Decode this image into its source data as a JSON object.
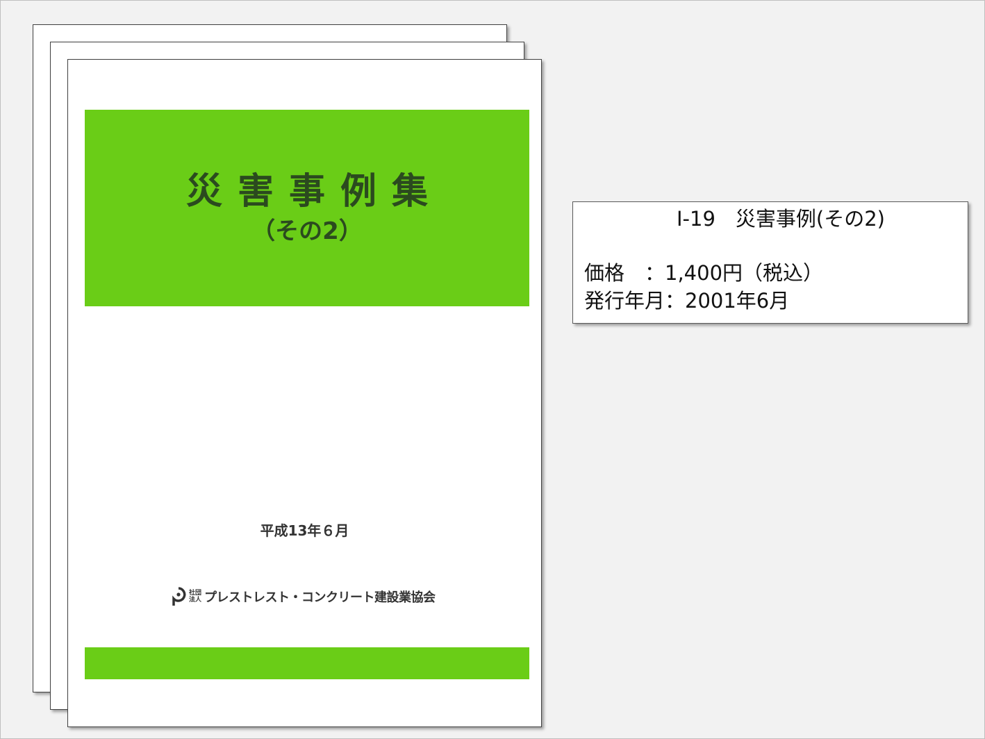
{
  "cover": {
    "title": "災害事例集",
    "subtitle": "（その2）",
    "date": "平成13年６月",
    "publisher_prefix": "社団法人",
    "publisher_name": "プレストレスト・コンクリート建設業協会",
    "band_color": "#6acd17",
    "title_color": "#2b4a1f"
  },
  "info": {
    "heading": "Ⅰ-19　災害事例(その2)",
    "price_line": "価格　：1,400円（税込）",
    "date_line": "発行年月：2001年6月"
  }
}
